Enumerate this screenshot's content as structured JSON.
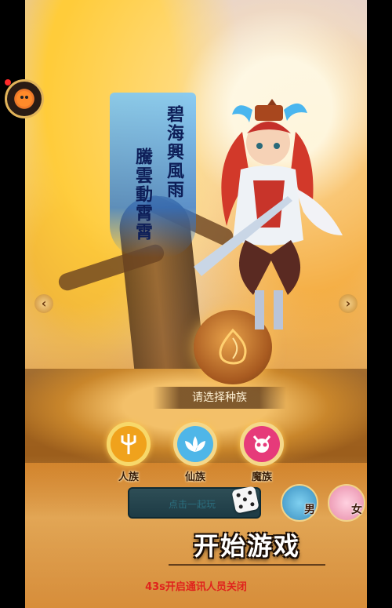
{
  "banner": {
    "line1": "碧海興風雨",
    "line2": "騰雲動霄霄"
  },
  "race_select": {
    "title": "请选择种族",
    "races": [
      {
        "label": "人族",
        "color": "#f0a21c"
      },
      {
        "label": "仙族",
        "color": "#4fb6e8"
      },
      {
        "label": "魔族",
        "color": "#e63a7a"
      }
    ]
  },
  "name_input": {
    "placeholder": "点击一起玩"
  },
  "gender": {
    "male": "男",
    "female": "女"
  },
  "start_button": "开始游戏",
  "footer_note": "43s开启通讯人员关闭",
  "nav": {
    "prev": "‹",
    "next": "›"
  }
}
